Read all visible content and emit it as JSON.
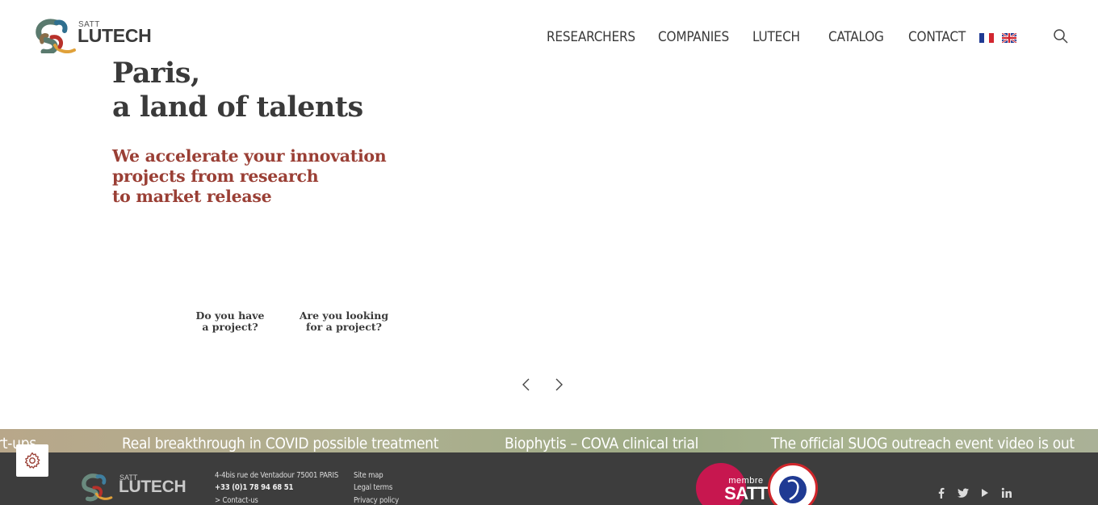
{
  "header": {
    "logo": {
      "satt": "SATT",
      "name": "LUTECH"
    },
    "nav": [
      {
        "label": "RESEARCHERS"
      },
      {
        "label": "COMPANIES"
      },
      {
        "label": "LUTECH"
      },
      {
        "label": "CATALOG"
      },
      {
        "label": "CONTACT"
      }
    ],
    "languages": [
      "fr-flag-icon",
      "uk-flag-icon"
    ],
    "search_icon": "search-icon"
  },
  "hero": {
    "title_line1": "Paris,",
    "title_line2": "a land of talents",
    "subtitle_line1": "We accelerate your innovation",
    "subtitle_line2": "projects from research",
    "subtitle_line3": "to market release",
    "cta_project_line1": "Do you have",
    "cta_project_line2": "a project?",
    "cta_looking_line1": "Are you looking",
    "cta_looking_line2": "for a project?"
  },
  "ticker": {
    "items": [
      "art-ups",
      "Real breakthrough in COVID possible treatment",
      "Biophytis – COVA clinical trial",
      "The official SUOG outreach event video is out"
    ]
  },
  "footer": {
    "logo": {
      "satt": "SATT",
      "name": "LUTECH"
    },
    "address": "4-4bis rue de Ventadour 75001 PARIS",
    "phone": "+33 (0)1 78 94 68 51",
    "contact": "> Contact-us",
    "links": [
      "Site map",
      "Legal terms",
      "Privacy policy"
    ],
    "badge_satt": {
      "small": "membre",
      "big": "SATT"
    },
    "social": [
      "facebook-icon",
      "twitter-icon",
      "youtube-icon",
      "linkedin-icon"
    ]
  },
  "colors": {
    "accent": "#9a3f35",
    "text": "#3a3a3a",
    "footer_bg": "#3d3d3d",
    "satt_badge": "#c7174f"
  }
}
